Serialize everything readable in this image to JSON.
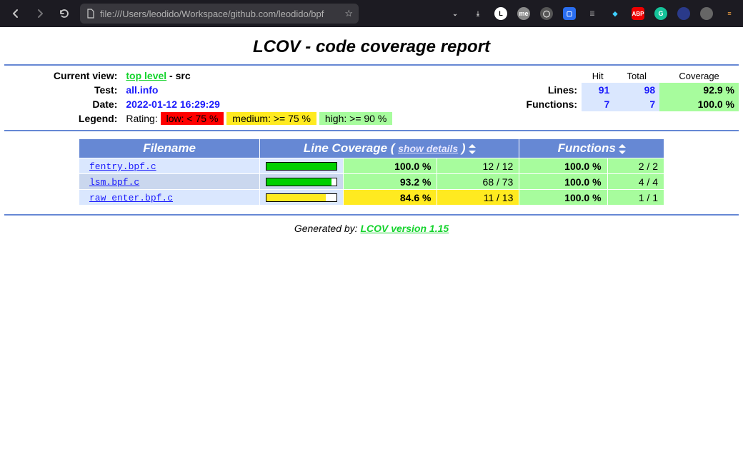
{
  "browser": {
    "url": "file:///Users/leodido/Workspace/github.com/leodido/bpf"
  },
  "title": "LCOV - code coverage report",
  "header": {
    "current_view_label": "Current view:",
    "top_level": "top level",
    "breadcrumb_rest": " - src",
    "test_label": "Test:",
    "test_value": "all.info",
    "date_label": "Date:",
    "date_value": "2022-01-12 16:29:29",
    "legend_label": "Legend:",
    "rating_label": "Rating:",
    "low_text": "low: < 75 %",
    "med_text": "medium: >= 75 %",
    "high_text": "high: >= 90 %",
    "col_hit": "Hit",
    "col_total": "Total",
    "col_coverage": "Coverage",
    "lines_label": "Lines:",
    "lines_hit": "91",
    "lines_total": "98",
    "lines_cov": "92.9 %",
    "funcs_label": "Functions:",
    "funcs_hit": "7",
    "funcs_total": "7",
    "funcs_cov": "100.0 %"
  },
  "table": {
    "col_filename": "Filename",
    "col_linecov_pre": "Line Coverage ( ",
    "show_details": "show details",
    "col_linecov_post": " )",
    "col_functions": "Functions",
    "rows": [
      {
        "file": "fentry.bpf.c",
        "line_pct": "100.0 %",
        "line_cnt": "12 / 12",
        "line_bar": 100,
        "line_class": "high",
        "func_pct": "100.0 %",
        "func_cnt": "2 / 2",
        "func_class": "high"
      },
      {
        "file": "lsm.bpf.c",
        "line_pct": "93.2 %",
        "line_cnt": "68 / 73",
        "line_bar": 93.2,
        "line_class": "high",
        "func_pct": "100.0 %",
        "func_cnt": "4 / 4",
        "func_class": "high"
      },
      {
        "file": "raw_enter.bpf.c",
        "line_pct": "84.6 %",
        "line_cnt": "11 / 13",
        "line_bar": 84.6,
        "line_class": "med",
        "func_pct": "100.0 %",
        "func_cnt": "1 / 1",
        "func_class": "high"
      }
    ]
  },
  "footer": {
    "generated_by": "Generated by: ",
    "lcov_link": "LCOV version 1.15"
  }
}
